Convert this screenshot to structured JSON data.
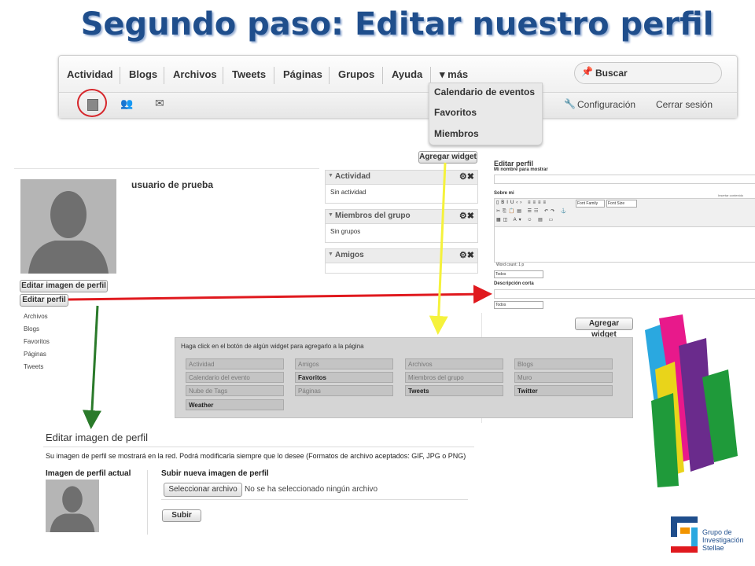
{
  "slide": {
    "title": "Segundo paso: Editar nuestro perfil"
  },
  "navbar": {
    "items": [
      "Actividad",
      "Blogs",
      "Archivos",
      "Tweets",
      "Páginas",
      "Grupos",
      "Ayuda"
    ],
    "more_label": "▾ más",
    "search_label": "Buscar",
    "config_label": "Configuración",
    "logout_label": "Cerrar sesión",
    "dropdown": [
      "Calendario de eventos",
      "Favoritos",
      "Miembros"
    ]
  },
  "profile": {
    "username": "usuario de prueba",
    "edit_avatar_button": "Editar imagen de perfil",
    "edit_profile_button": "Editar perfil",
    "links": [
      "Archivos",
      "Blogs",
      "Favoritos",
      "Páginas",
      "Tweets"
    ],
    "add_widget_button": "Agregar widget",
    "widgets": [
      {
        "title": "Actividad",
        "body": "Sin actividad"
      },
      {
        "title": "Miembros del grupo",
        "body": "Sin grupos"
      },
      {
        "title": "Amigos",
        "body": ""
      }
    ]
  },
  "editor": {
    "title": "Editar perfil",
    "name_label": "Mi nombre para mostrar",
    "about_label": "Sobre mi",
    "insert_link": "Insertar contenido",
    "font_family": "Font Family",
    "font_size": "Font Size",
    "word_count": "Word count: 1 p",
    "access_select": "Todos",
    "short_desc_label": "Descripción corta",
    "access_select_2": "Todos"
  },
  "chooser": {
    "add_widget_button": "Agregar widget",
    "instruction": "Haga click en el botón de algún widget para agregarlo a la página",
    "cells": [
      {
        "label": "Actividad",
        "active": false
      },
      {
        "label": "Amigos",
        "active": false
      },
      {
        "label": "Archivos",
        "active": false
      },
      {
        "label": "Blogs",
        "active": false
      },
      {
        "label": "Calendario del evento",
        "active": false
      },
      {
        "label": "Favoritos",
        "active": true
      },
      {
        "label": "Miembros del grupo",
        "active": false
      },
      {
        "label": "Muro",
        "active": false
      },
      {
        "label": "Nube de Tags",
        "active": false
      },
      {
        "label": "Páginas",
        "active": false
      },
      {
        "label": "Tweets",
        "active": true
      },
      {
        "label": "Twitter",
        "active": true
      },
      {
        "label": "Weather",
        "active": true
      }
    ]
  },
  "edit_avatar": {
    "title": "Editar imagen de perfil",
    "description": "Su imagen de perfil se mostrará en la red. Podrá modificarla siempre que lo desee (Formatos de archivo aceptados: GIF, JPG o PNG)",
    "current_label": "Imagen de perfil actual",
    "upload_label": "Subir nueva imagen de perfil",
    "file_button": "Seleccionar archivo",
    "file_status": "No se ha seleccionado ningún archivo",
    "submit_button": "Subir"
  },
  "branding": {
    "group_line1": "Grupo de",
    "group_line2": "Investigación",
    "group_line3": "Stellae"
  },
  "colors": {
    "title": "#1f4e8c",
    "red_arrow": "#e0191e",
    "yellow_arrow": "#f5f23c",
    "green_arrow": "#2a7a2a"
  }
}
